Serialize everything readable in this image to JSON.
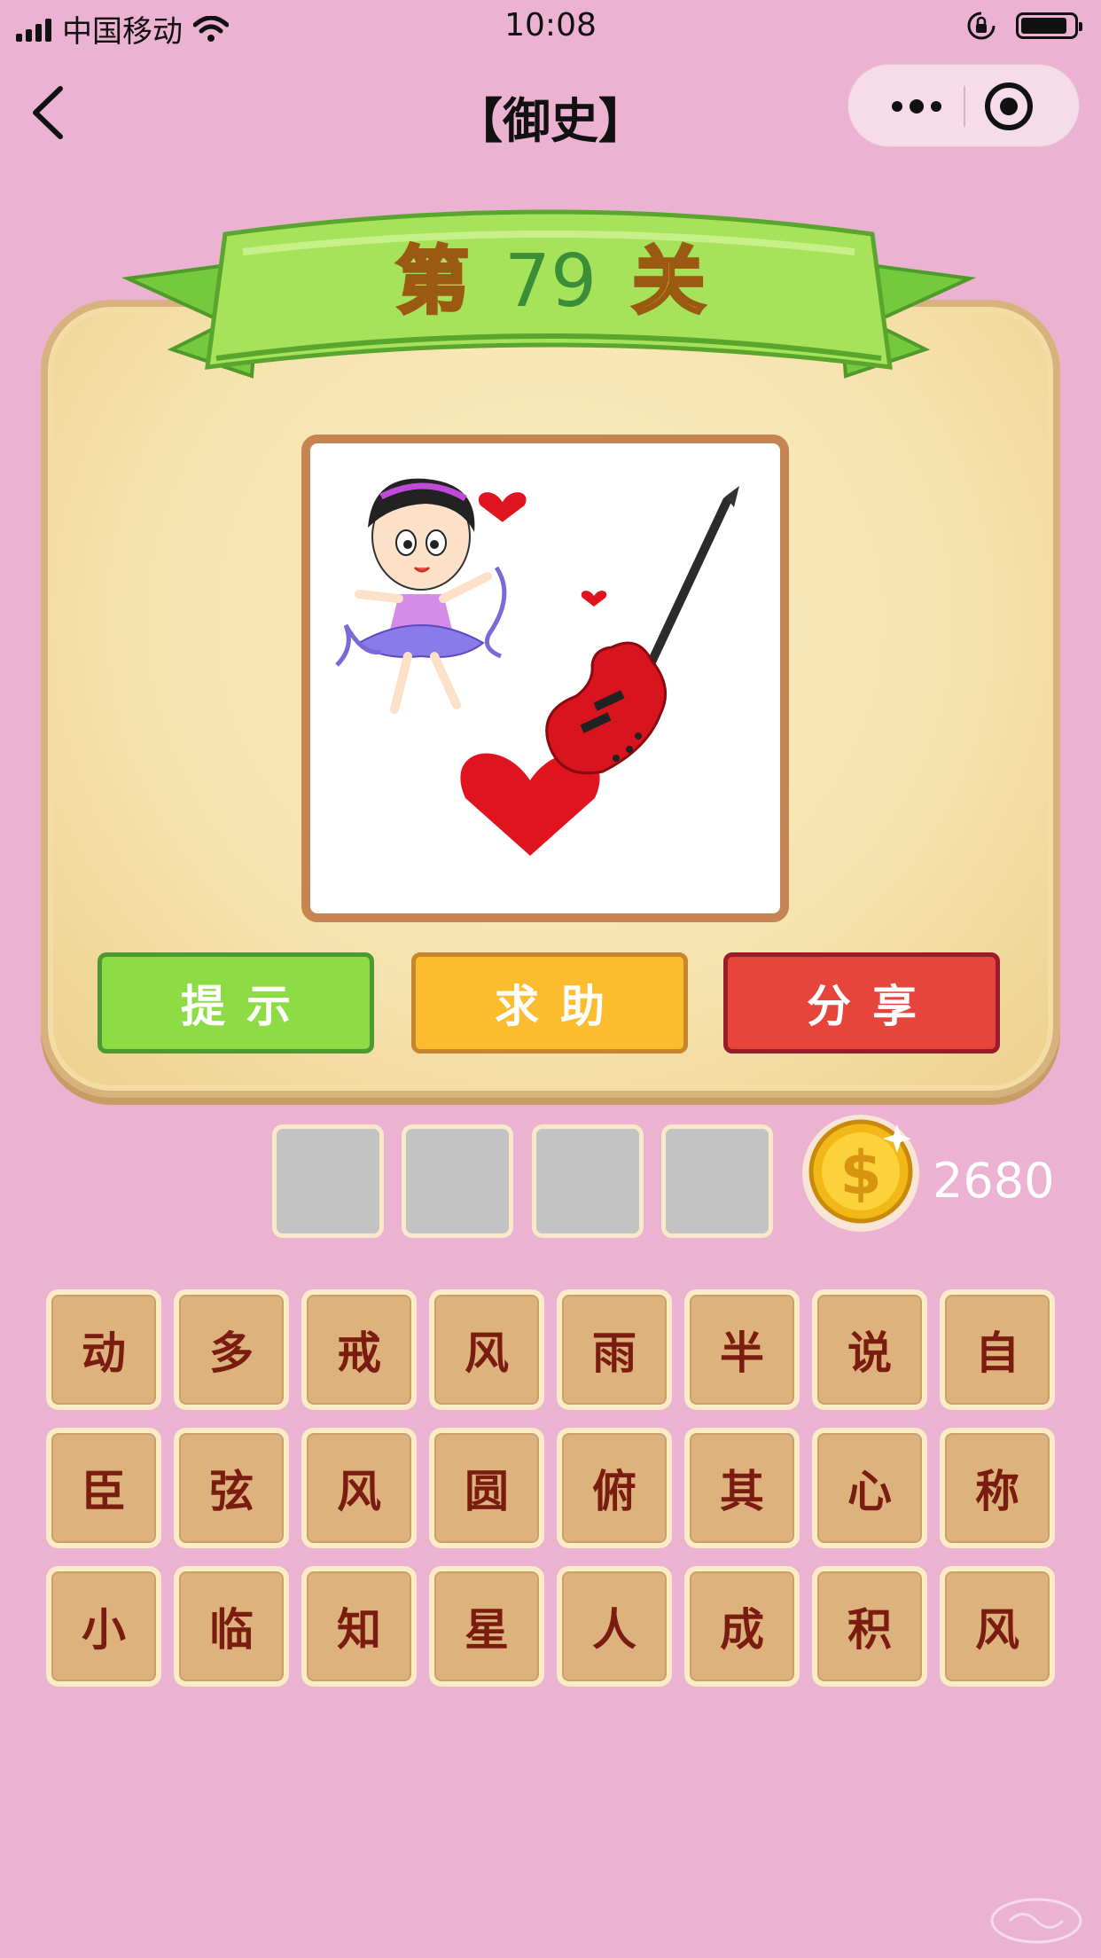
{
  "status_bar": {
    "carrier": "中国移动",
    "time": "10:08"
  },
  "nav": {
    "title": "【御史】"
  },
  "level": {
    "prefix": "第",
    "number": "79",
    "suffix": "关"
  },
  "puzzle_image": {
    "icons": [
      "ballerina-girl",
      "heart",
      "electric-guitar"
    ]
  },
  "actions": {
    "hint": "提示",
    "help": "求助",
    "share": "分享"
  },
  "answer_slots": [
    "",
    "",
    "",
    ""
  ],
  "coins": "2680",
  "characters": [
    [
      "动",
      "多",
      "戒",
      "风",
      "雨",
      "半",
      "说",
      "自"
    ],
    [
      "臣",
      "弦",
      "风",
      "圆",
      "俯",
      "其",
      "心",
      "称"
    ],
    [
      "小",
      "临",
      "知",
      "星",
      "人",
      "成",
      "积",
      "风"
    ]
  ],
  "colors": {
    "background": "#ecb2d2",
    "hint_button": "#8edc45",
    "help_button": "#fbbd2e",
    "share_button": "#e5453b",
    "tile": "#ddb27c",
    "tile_text": "#7a1d10"
  }
}
